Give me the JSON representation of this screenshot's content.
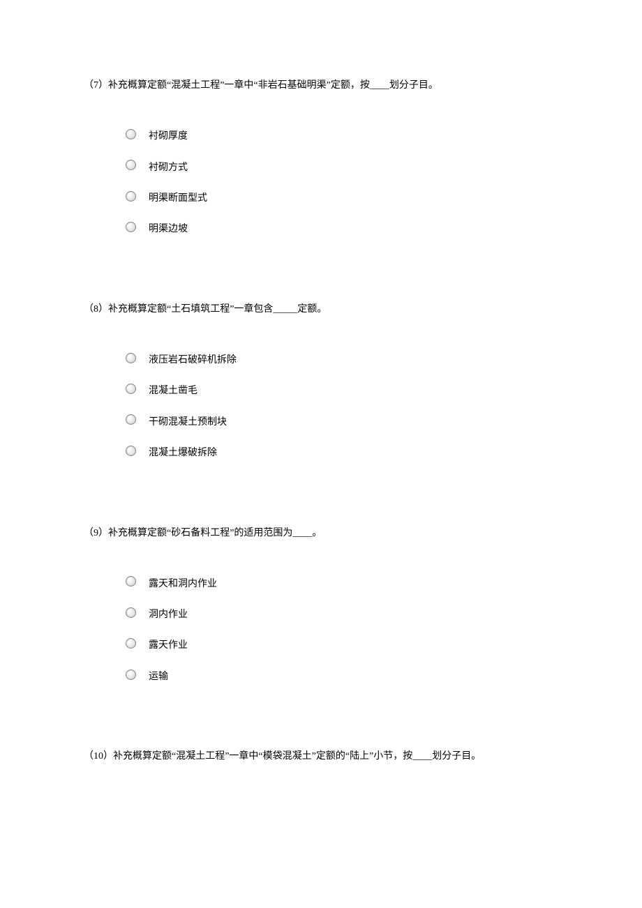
{
  "questions": [
    {
      "number": "（7）",
      "text": "补充概算定额“混凝土工程”一章中“非岩石基础明渠”定额，按____划分子目。",
      "options": [
        "衬砌厚度",
        "衬砌方式",
        "明渠断面型式",
        "明渠边坡"
      ]
    },
    {
      "number": "（8）",
      "text": "补充概算定额“土石填筑工程”一章包含_____定额。",
      "options": [
        "液压岩石破碎机拆除",
        "混凝土凿毛",
        "干砌混凝土预制块",
        "混凝土爆破拆除"
      ]
    },
    {
      "number": "（9）",
      "text": "补充概算定额“砂石备料工程”的适用范围为____。",
      "options": [
        "露天和洞内作业",
        "洞内作业",
        "露天作业",
        "运输"
      ]
    },
    {
      "number": "（10）",
      "text": "补充概算定额“混凝土工程”一章中“模袋混凝土”定额的“陆上”小节，按____划分子目。",
      "options": []
    }
  ]
}
